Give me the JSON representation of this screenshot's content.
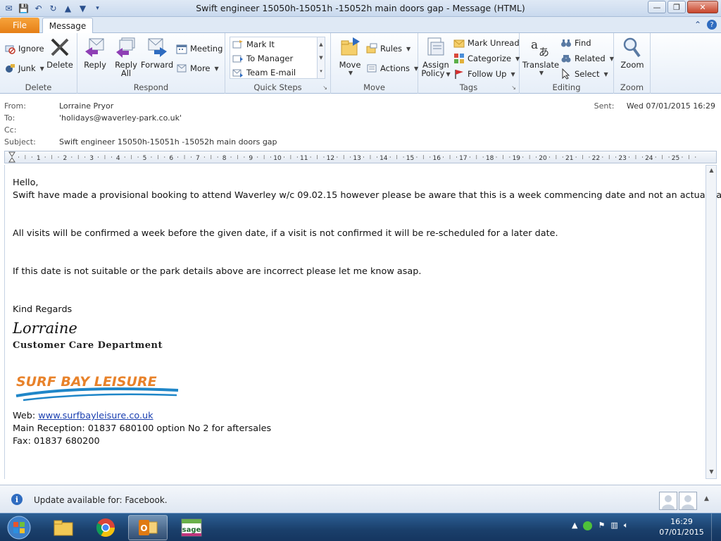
{
  "window": {
    "title": "Swift engineer 15050h-15051h -15052h main doors gap  -  Message (HTML)"
  },
  "tabs": {
    "file": "File",
    "message": "Message"
  },
  "ribbon": {
    "delete_group": {
      "label": "Delete",
      "ignore": "Ignore",
      "junk": "Junk",
      "delete": "Delete"
    },
    "respond_group": {
      "label": "Respond",
      "reply": "Reply",
      "reply_all_1": "Reply",
      "reply_all_2": "All",
      "forward": "Forward",
      "meeting": "Meeting",
      "more": "More"
    },
    "quick_steps_group": {
      "label": "Quick Steps",
      "items": [
        "Mark It",
        "To Manager",
        "Team E-mail"
      ]
    },
    "move_group": {
      "label": "Move",
      "move": "Move",
      "rules": "Rules",
      "actions": "Actions"
    },
    "tags_group": {
      "label": "Tags",
      "assign_1": "Assign",
      "assign_2": "Policy",
      "mark_unread": "Mark Unread",
      "categorize": "Categorize",
      "follow_up": "Follow Up"
    },
    "editing_group": {
      "label": "Editing",
      "translate": "Translate",
      "find": "Find",
      "related": "Related",
      "select": "Select"
    },
    "zoom_group": {
      "label": "Zoom",
      "zoom": "Zoom"
    }
  },
  "header": {
    "from_label": "From:",
    "from": "Lorraine Pryor",
    "to_label": "To:",
    "to": "'holidays@waverley-park.co.uk'",
    "cc_label": "Cc:",
    "cc": "",
    "subject_label": "Subject:",
    "subject": "Swift engineer 15050h-15051h -15052h main doors gap",
    "sent_label": "Sent:",
    "sent": "Wed 07/01/2015 16:29"
  },
  "ruler": {
    "numbers": [
      "1",
      "2",
      "3",
      "4",
      "5",
      "6",
      "7",
      "8",
      "9",
      "10",
      "11",
      "12",
      "13",
      "14",
      "15",
      "16",
      "17",
      "18",
      "19",
      "20",
      "21",
      "22",
      "23",
      "24",
      "25"
    ]
  },
  "body": {
    "greeting": "Hello,",
    "line1": "Swift have made a provisional booking to attend Waverley w/c 09.02.15 however please be aware that this is a week commencing date and not an actual date.",
    "line2": "All visits will be confirmed a week before the given date, if a visit is not confirmed it will be re-scheduled for a later date.",
    "line3": "If this date is not suitable or the park details above are incorrect please let me know asap.",
    "regards": "Kind Regards",
    "signature_name": "Lorraine",
    "department": "Customer Care Department",
    "logo_text": "SURF BAY LEISURE",
    "web_label": "Web: ",
    "web_link": "www.surfbayleisure.co.uk",
    "reception": "Main Reception:  01837 680100 option No 2 for aftersales",
    "fax": "Fax:  01837 680200"
  },
  "infobar": {
    "text": "Update available for: Facebook."
  },
  "taskbar": {
    "apps": [
      "windows-explorer",
      "google-chrome",
      "microsoft-outlook",
      "sage"
    ],
    "logo_sage": "sage",
    "time": "16:29",
    "date": "07/01/2015"
  },
  "colors": {
    "file_tab": "#e57f16",
    "link": "#1a3fb0",
    "taskbar": "#1a3f6b",
    "logo_orange": "#e8822a",
    "logo_blue": "#1f86c8"
  }
}
